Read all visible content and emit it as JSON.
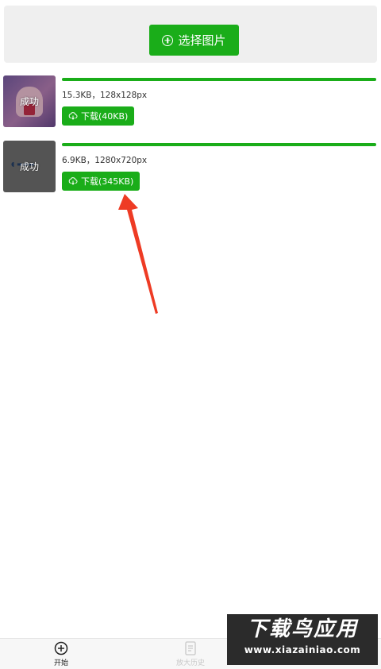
{
  "header": {
    "select_button_label": "选择图片"
  },
  "items": [
    {
      "status": "成功",
      "info": "15.3KB，128x128px",
      "download_label": "下载(40KB)",
      "progress": 1.0
    },
    {
      "status": "成功",
      "info": "6.9KB，1280x720px",
      "download_label": "下载(345KB)",
      "progress": 1.0
    }
  ],
  "tabbar": {
    "start_label": "开始",
    "history_label": "放大历史"
  },
  "watermark": {
    "title": "下载鸟应用",
    "url": "www.xiazainiao.com"
  },
  "colors": {
    "accent": "#1aad19",
    "arrow": "#ee3b24"
  },
  "icons": {
    "select": "plus-circle-icon",
    "download": "cloud-download-icon",
    "start_tab": "plus-circle-icon",
    "history_tab": "document-icon"
  }
}
